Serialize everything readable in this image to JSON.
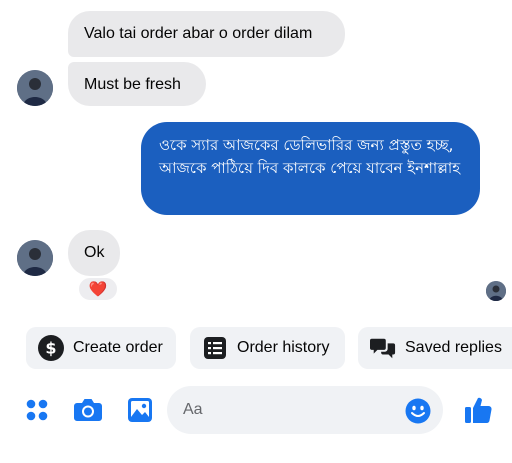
{
  "messages": [
    {
      "text": "Valo tai order abar o order dilam",
      "direction": "incoming"
    },
    {
      "text": "Must be fresh",
      "direction": "incoming"
    },
    {
      "text": "ওকে স্যার আজকের ডেলিভারির জন্য প্রস্তুত হচ্ছ, আজকে পাঠিয়ে দিব কালকে পেয়ে যাবেন ইনশাল্লাহ",
      "direction": "outgoing"
    },
    {
      "text": "Ok",
      "direction": "incoming"
    }
  ],
  "reaction": {
    "emoji": "❤️"
  },
  "quick_actions": [
    {
      "label": "Create order",
      "icon": "dollar-icon"
    },
    {
      "label": "Order history",
      "icon": "order-list-icon"
    },
    {
      "label": "Saved replies",
      "icon": "chat-bubbles-icon"
    }
  ],
  "composer": {
    "placeholder": "Aa",
    "icons": [
      "apps-grid-icon",
      "camera-icon",
      "image-icon",
      "emoji-icon",
      "thumbs-up-icon"
    ]
  },
  "colors": {
    "accent": "#1877f2",
    "outgoing_bubble": "#1b5fbf",
    "incoming_bubble": "#e9e9eb"
  }
}
